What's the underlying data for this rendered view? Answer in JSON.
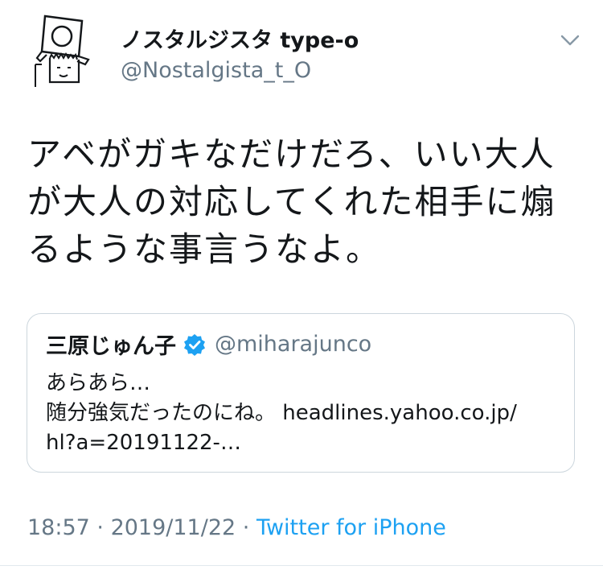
{
  "author": {
    "display_name": "ノスタルジスタ type-o",
    "handle": "@Nostalgista_t_O"
  },
  "tweet": {
    "lines": [
      "アベがガキなだけだろ、いい大人",
      "が大人の対応してくれた相手に煽",
      "るような事言うなよ。"
    ]
  },
  "quote": {
    "name": "三原じゅん子",
    "handle": "@miharajunco",
    "lines": [
      "あらあら…",
      "随分強気だったのにね。 headlines.yahoo.co.jp/",
      "hl?a=20191122-…"
    ]
  },
  "meta": {
    "time": "18:57",
    "separator_1": " · ",
    "date": "2019/11/22",
    "separator_2": " · ",
    "source": "Twitter for iPhone"
  },
  "icons": {
    "avatar": "drawn-avatar",
    "menu": "chevron-down-icon",
    "verified": "verified-badge-icon"
  },
  "colors": {
    "text": "#14171a",
    "secondary": "#657786",
    "link": "#1da1f2",
    "border": "#ccd6dd"
  }
}
